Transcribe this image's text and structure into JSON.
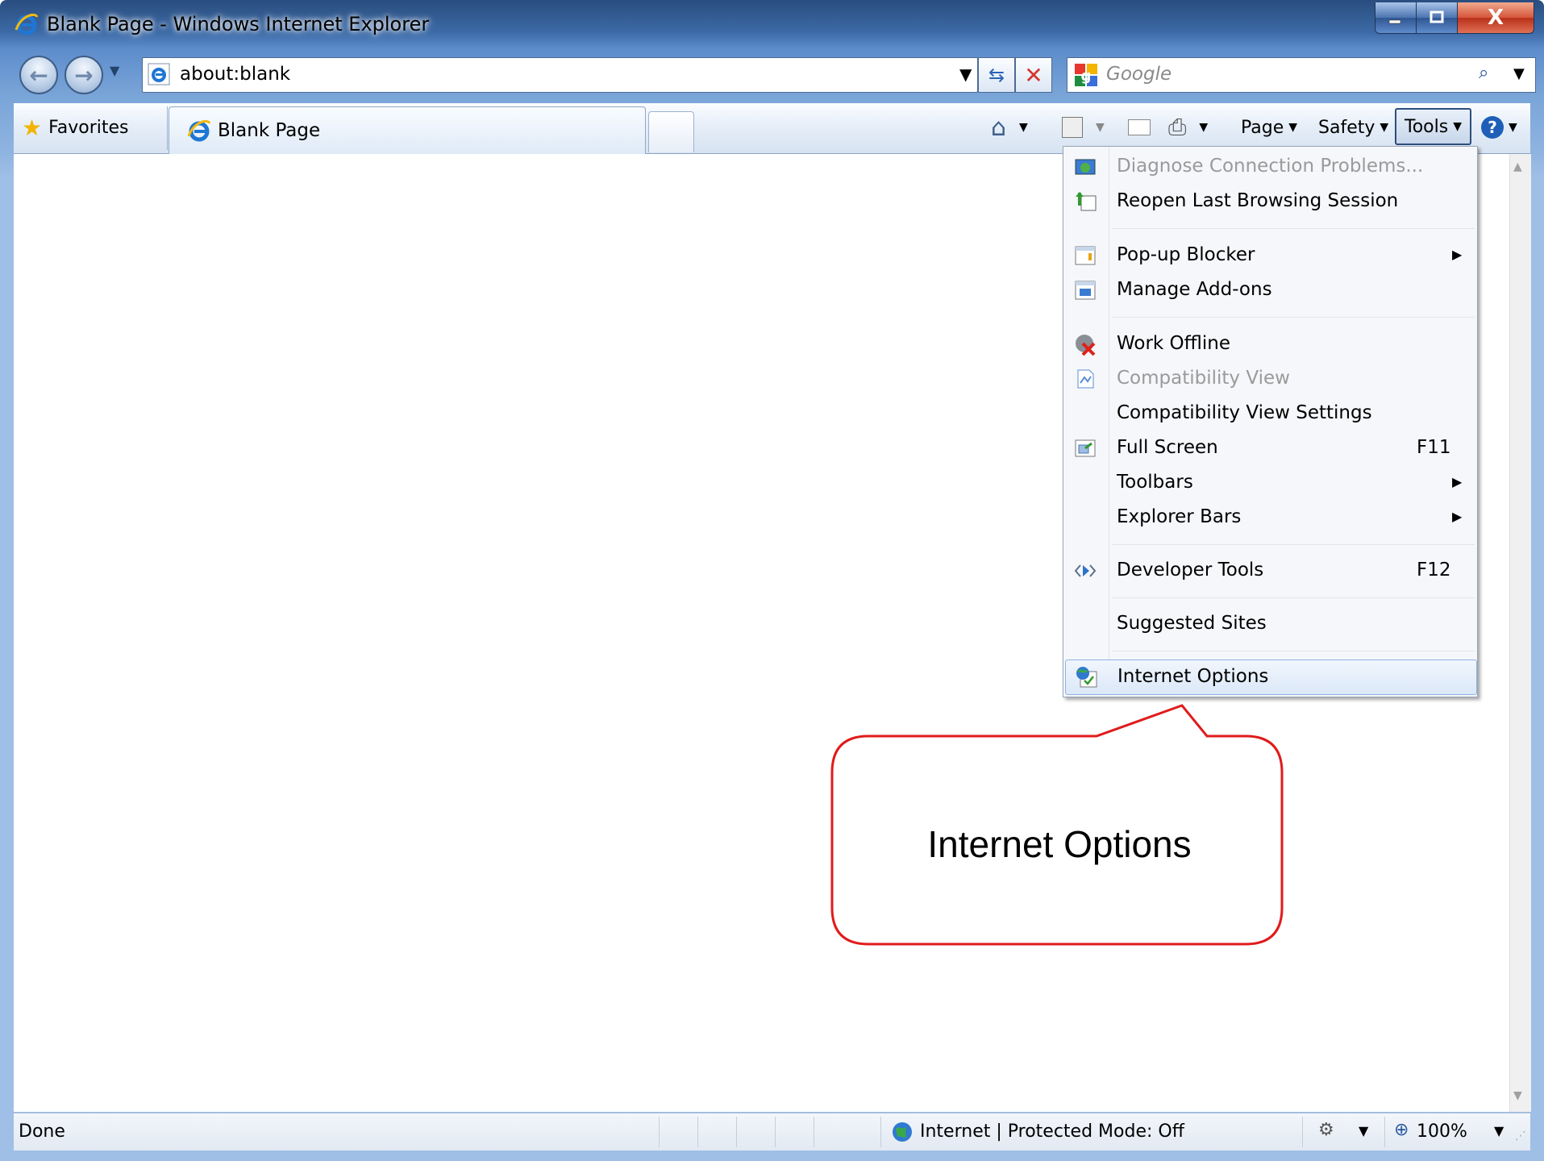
{
  "window": {
    "title": "Blank Page - Windows Internet Explorer",
    "minimize_label": "",
    "maximize_label": "",
    "close_label": "X"
  },
  "navigation": {
    "address": "about:blank",
    "search_placeholder": "Google"
  },
  "command_bar": {
    "favorites_label": "Favorites",
    "tab_title": "Blank Page",
    "page_label": "Page",
    "safety_label": "Safety",
    "tools_label": "Tools"
  },
  "tools_menu": {
    "items": [
      {
        "label": "Diagnose Connection Problems...",
        "shortcut": "",
        "disabled": true
      },
      {
        "label": "Reopen Last Browsing Session",
        "shortcut": ""
      },
      {
        "label": "Pop-up Blocker",
        "shortcut": "",
        "submenu": true
      },
      {
        "label": "Manage Add-ons",
        "shortcut": ""
      },
      {
        "label": "Work Offline",
        "shortcut": ""
      },
      {
        "label": "Compatibility View",
        "shortcut": "",
        "disabled": true
      },
      {
        "label": "Compatibility View Settings",
        "shortcut": ""
      },
      {
        "label": "Full Screen",
        "shortcut": "F11"
      },
      {
        "label": "Toolbars",
        "shortcut": "",
        "submenu": true
      },
      {
        "label": "Explorer Bars",
        "shortcut": "",
        "submenu": true
      },
      {
        "label": "Developer Tools",
        "shortcut": "F12"
      },
      {
        "label": "Suggested Sites",
        "shortcut": ""
      },
      {
        "label": "Internet Options",
        "shortcut": "",
        "highlighted": true
      }
    ]
  },
  "status_bar": {
    "status_text": "Done",
    "zone_text": "Internet | Protected Mode: Off",
    "zoom_text": "100%"
  },
  "callout": {
    "text": "Internet Options"
  },
  "icons": {
    "browser": "ie-logo-icon",
    "back": "back-arrow-icon",
    "forward": "forward-arrow-icon",
    "refresh": "refresh-icon",
    "stop": "stop-icon",
    "search": "search-icon",
    "favorites": "star-icon",
    "home": "home-icon",
    "feeds": "rss-icon",
    "mail": "mail-icon",
    "print": "printer-icon",
    "help": "help-icon",
    "zone": "globe-icon"
  },
  "colors": {
    "callout_border": "#e01b1b",
    "menu_highlight": "#dbe8f8",
    "window_frame": "#3c6aa6"
  }
}
